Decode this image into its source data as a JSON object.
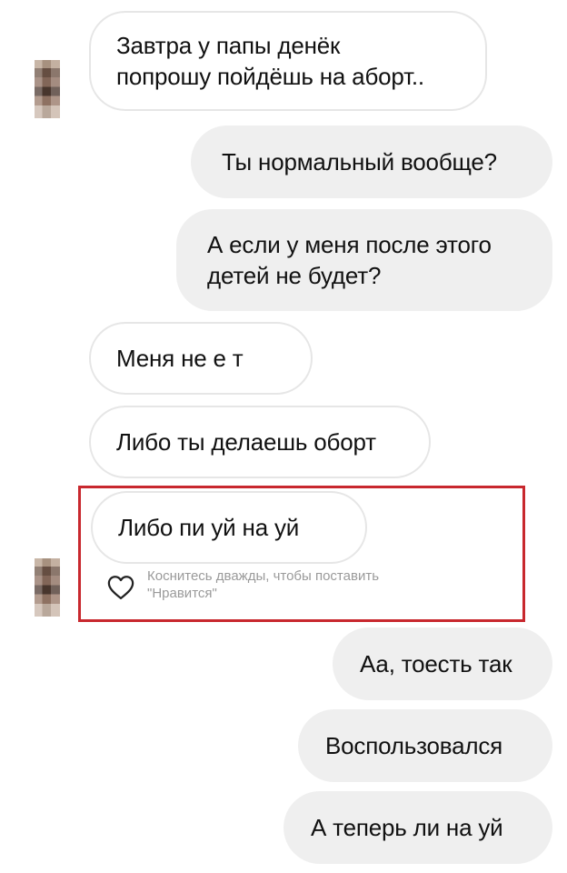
{
  "chat": {
    "messages": [
      {
        "side": "incoming",
        "text": "Завтра у папы денёк\nпопрошу пойдёшь на аборт.."
      },
      {
        "side": "outgoing",
        "text": "Ты нормальный вообще?"
      },
      {
        "side": "outgoing",
        "text": "А если у меня после этого\nдетей не будет?"
      },
      {
        "side": "incoming",
        "text": "Меня не е т"
      },
      {
        "side": "incoming",
        "text": "Либо ты делаешь оборт"
      },
      {
        "side": "incoming",
        "text": "Либо пи уй на уй"
      },
      {
        "side": "outgoing",
        "text": "Аа, тоесть так"
      },
      {
        "side": "outgoing",
        "text": "Воспользовался"
      },
      {
        "side": "outgoing",
        "text": "А теперь ли на уй"
      }
    ],
    "like_hint": "Коснитесь дважды, чтобы поставить\n\"Нравится\""
  },
  "colors": {
    "highlight_border": "#c8282e",
    "outgoing_bubble": "#efefef",
    "incoming_border": "#e6e6e6",
    "hint_text": "#9a9a9a"
  },
  "icons": {
    "like": "heart-outline-icon",
    "avatar": "avatar-pixelated"
  }
}
